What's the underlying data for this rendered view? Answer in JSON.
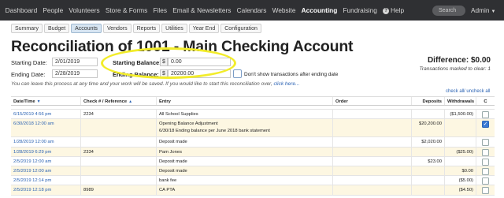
{
  "nav": {
    "items": [
      "Dashboard",
      "People",
      "Volunteers",
      "Store & Forms",
      "Files",
      "Email & Newsletters",
      "Calendars",
      "Website",
      "Accounting",
      "Fundraising"
    ],
    "active": "Accounting",
    "help": "Help",
    "search_placeholder": "Search",
    "admin": "Admin"
  },
  "subtabs": [
    "Summary",
    "Budget",
    "Accounts",
    "Vendors",
    "Reports",
    "Utilities",
    "Year End",
    "Configuration"
  ],
  "active_subtab": "Accounts",
  "page_title": "Reconciliation of 1001 - Main Checking Account",
  "form": {
    "starting_date_label": "Starting Date:",
    "starting_date_value": "2/01/2019",
    "ending_date_label": "Ending Date:",
    "ending_date_value": "2/28/2019",
    "starting_balance_label": "Starting Balance:",
    "starting_balance_value": "0.00",
    "ending_balance_label": "Ending Balance:",
    "ending_balance_value": "20200.00",
    "currency": "$",
    "dont_show_label": "Don't show transactions after ending date"
  },
  "note": {
    "text": "You can leave this process at any time and your work will be saved. If you would like to start this reconciliation over,",
    "link": "click here..."
  },
  "difference": {
    "label": "Difference: $0.00",
    "sub": "Transactions marked to clear: 1"
  },
  "check_links": {
    "check_all": "check all",
    "uncheck_all": "/ uncheck all"
  },
  "table": {
    "headers": {
      "date": "Date/Time",
      "check": "Check # / Reference",
      "entry": "Entry",
      "order": "Order",
      "deposits": "Deposits",
      "withdrawals": "Withdrawals",
      "c": "C"
    },
    "rows": [
      {
        "date": "6/15/2019 4:56 pm",
        "check": "2234",
        "entry": "All School Supplies",
        "entry2": "",
        "order": "",
        "deposits": "",
        "withdrawals": "($1,500.00)",
        "checked": false,
        "alt": false
      },
      {
        "date": "6/30/2018 12:00 am",
        "check": "",
        "entry": "Opening Balance Adjustment",
        "entry2": "6/30/18 Ending balance per June 2018 bank statement",
        "order": "",
        "deposits": "$20,200.00",
        "withdrawals": "",
        "checked": true,
        "alt": true
      },
      {
        "date": "1/28/2019 12:00 am",
        "check": "",
        "entry": "Deposit made",
        "entry2": "",
        "order": "",
        "deposits": "$2,020.00",
        "withdrawals": "",
        "checked": false,
        "alt": false
      },
      {
        "date": "1/28/2019 6:29 pm",
        "check": "2334",
        "entry": "Pam Jones",
        "entry2": "",
        "order": "",
        "deposits": "",
        "withdrawals": "($25.00)",
        "checked": false,
        "alt": true
      },
      {
        "date": "2/5/2019 12:00 am",
        "check": "",
        "entry": "Deposit made",
        "entry2": "",
        "order": "",
        "deposits": "$23.00",
        "withdrawals": "",
        "checked": false,
        "alt": false
      },
      {
        "date": "2/5/2019 12:00 am",
        "check": "",
        "entry": "Deposit made",
        "entry2": "",
        "order": "",
        "deposits": "",
        "withdrawals": "$0.00",
        "checked": false,
        "alt": true
      },
      {
        "date": "2/5/2019 12:14 pm",
        "check": "",
        "entry": "bank fee",
        "entry2": "",
        "order": "",
        "deposits": "",
        "withdrawals": "($5.00)",
        "checked": false,
        "alt": false
      },
      {
        "date": "2/5/2019 12:18 pm",
        "check": "8989",
        "entry": "CA PTA",
        "entry2": "",
        "order": "",
        "deposits": "",
        "withdrawals": "($4.50)",
        "checked": false,
        "alt": true
      }
    ]
  },
  "colors": {
    "nav_bg": "#2f3033",
    "link": "#2a62b3",
    "highlight": "#f2ec2a",
    "alt_row": "#fdf7e2"
  }
}
